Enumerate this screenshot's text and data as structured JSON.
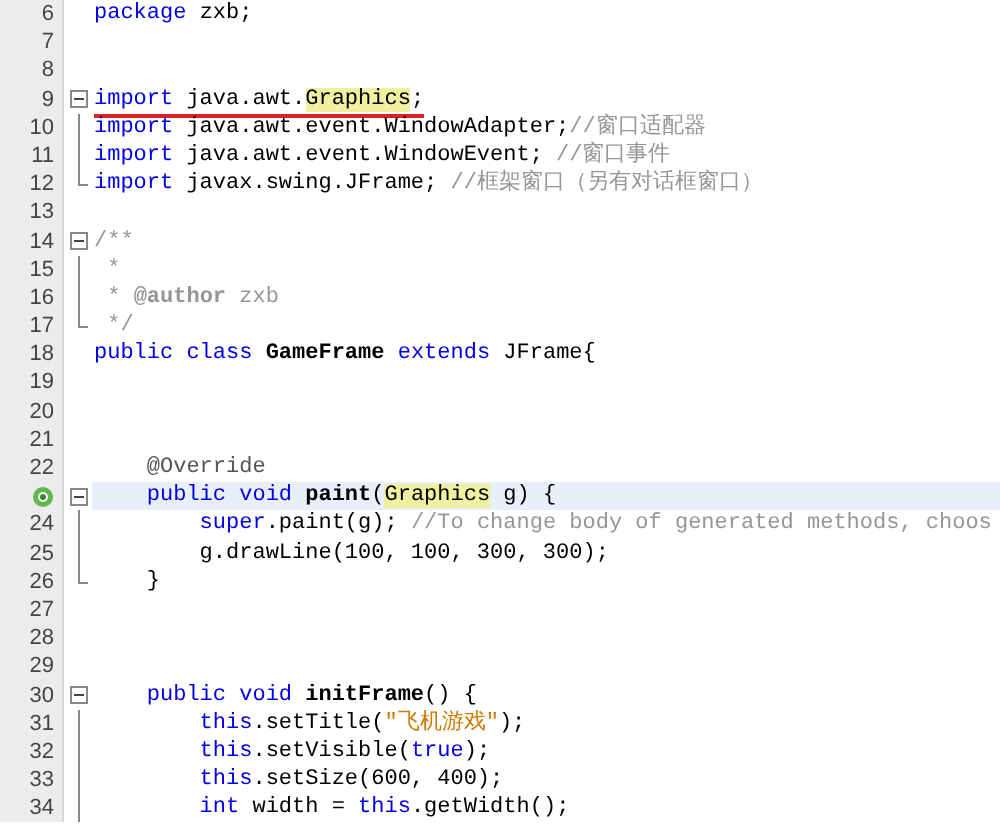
{
  "editor": {
    "lines": [
      {
        "number": "6",
        "kind": "plain",
        "segments": [
          {
            "kind": "keyword",
            "t": "package"
          },
          {
            "kind": "plain",
            "t": " zxb;"
          }
        ]
      },
      {
        "number": "7",
        "kind": "plain"
      },
      {
        "number": "8",
        "kind": "plain"
      },
      {
        "number": "9",
        "kind": "fold_start",
        "underlined": true,
        "segments": [
          {
            "kind": "keyword",
            "t": "import"
          },
          {
            "kind": "plain",
            "t": " java.awt."
          },
          {
            "kind": "occurrence",
            "t": "Graphics"
          },
          {
            "kind": "plain",
            "t": ";"
          }
        ]
      },
      {
        "number": "10",
        "kind": "fold_body",
        "segments": [
          {
            "kind": "keyword",
            "t": "import"
          },
          {
            "kind": "plain",
            "t": " java.awt.event.WindowAdapter;"
          },
          {
            "kind": "comment",
            "t": "//窗口适配器"
          }
        ]
      },
      {
        "number": "11",
        "kind": "fold_body",
        "segments": [
          {
            "kind": "keyword",
            "t": "import"
          },
          {
            "kind": "plain",
            "t": " java.awt.event.WindowEvent; "
          },
          {
            "kind": "comment",
            "t": "//窗口事件"
          }
        ]
      },
      {
        "number": "12",
        "kind": "fold_end",
        "segments": [
          {
            "kind": "keyword",
            "t": "import"
          },
          {
            "kind": "plain",
            "t": " javax.swing.JFrame; "
          },
          {
            "kind": "comment",
            "t": "//框架窗口（另有对话框窗口）"
          }
        ]
      },
      {
        "number": "13",
        "kind": "plain"
      },
      {
        "number": "14",
        "kind": "fold_start",
        "segments": [
          {
            "kind": "comment",
            "t": "/**"
          }
        ]
      },
      {
        "number": "15",
        "kind": "fold_body",
        "segments": [
          {
            "kind": "comment",
            "t": " *"
          }
        ]
      },
      {
        "number": "16",
        "kind": "fold_body",
        "segments": [
          {
            "kind": "comment",
            "t": " * "
          },
          {
            "kind": "doctag",
            "t": "@author"
          },
          {
            "kind": "comment",
            "t": " zxb"
          }
        ]
      },
      {
        "number": "17",
        "kind": "fold_end",
        "segments": [
          {
            "kind": "comment",
            "t": " */"
          }
        ]
      },
      {
        "number": "18",
        "kind": "plain",
        "segments": [
          {
            "kind": "keyword",
            "t": "public class "
          },
          {
            "kind": "bold",
            "t": "GameFrame"
          },
          {
            "kind": "keyword",
            "t": " extends"
          },
          {
            "kind": "plain",
            "t": " JFrame{"
          }
        ]
      },
      {
        "number": "19",
        "kind": "plain"
      },
      {
        "number": "20",
        "kind": "plain"
      },
      {
        "number": "21",
        "kind": "plain"
      },
      {
        "number": "22",
        "kind": "plain",
        "segments": [
          {
            "kind": "annotation",
            "t": "    @Override"
          }
        ]
      },
      {
        "override_marker": true,
        "kind": "fold_start",
        "current": true,
        "segments": [
          {
            "kind": "keyword",
            "t": "    public void "
          },
          {
            "kind": "bold",
            "t": "paint"
          },
          {
            "kind": "plain",
            "t": "("
          },
          {
            "kind": "occurrence",
            "t": "Graphics"
          },
          {
            "kind": "plain",
            "t": " g) {"
          }
        ]
      },
      {
        "number": "24",
        "kind": "fold_body",
        "segments": [
          {
            "kind": "keyword",
            "t": "        super"
          },
          {
            "kind": "plain",
            "t": ".paint(g); "
          },
          {
            "kind": "comment",
            "t": "//To change body of generated methods, choos"
          }
        ]
      },
      {
        "number": "25",
        "kind": "fold_body",
        "segments": [
          {
            "kind": "plain",
            "t": "        g.drawLine(100, 100, 300, 300);"
          }
        ]
      },
      {
        "number": "26",
        "kind": "fold_end",
        "segments": [
          {
            "kind": "plain",
            "t": "    }"
          }
        ]
      },
      {
        "number": "27",
        "kind": "plain"
      },
      {
        "number": "28",
        "kind": "plain"
      },
      {
        "number": "29",
        "kind": "plain"
      },
      {
        "number": "30",
        "kind": "fold_start",
        "segments": [
          {
            "kind": "keyword",
            "t": "    public void "
          },
          {
            "kind": "bold",
            "t": "initFrame"
          },
          {
            "kind": "plain",
            "t": "() {"
          }
        ]
      },
      {
        "number": "31",
        "kind": "fold_body",
        "segments": [
          {
            "kind": "keyword",
            "t": "        this"
          },
          {
            "kind": "plain",
            "t": ".setTitle("
          },
          {
            "kind": "string",
            "t": "\"飞机游戏\""
          },
          {
            "kind": "plain",
            "t": ");"
          }
        ]
      },
      {
        "number": "32",
        "kind": "fold_body",
        "segments": [
          {
            "kind": "keyword",
            "t": "        this"
          },
          {
            "kind": "plain",
            "t": ".setVisible("
          },
          {
            "kind": "keyword",
            "t": "true"
          },
          {
            "kind": "plain",
            "t": ");"
          }
        ]
      },
      {
        "number": "33",
        "kind": "fold_body",
        "segments": [
          {
            "kind": "keyword",
            "t": "        this"
          },
          {
            "kind": "plain",
            "t": ".setSize(600, 400);"
          }
        ]
      },
      {
        "number": "34",
        "kind": "fold_body",
        "segments": [
          {
            "kind": "keyword",
            "t": "        int"
          },
          {
            "kind": "plain",
            "t": " width = "
          },
          {
            "kind": "keyword",
            "t": "this"
          },
          {
            "kind": "plain",
            "t": ".getWidth();"
          }
        ]
      }
    ]
  }
}
